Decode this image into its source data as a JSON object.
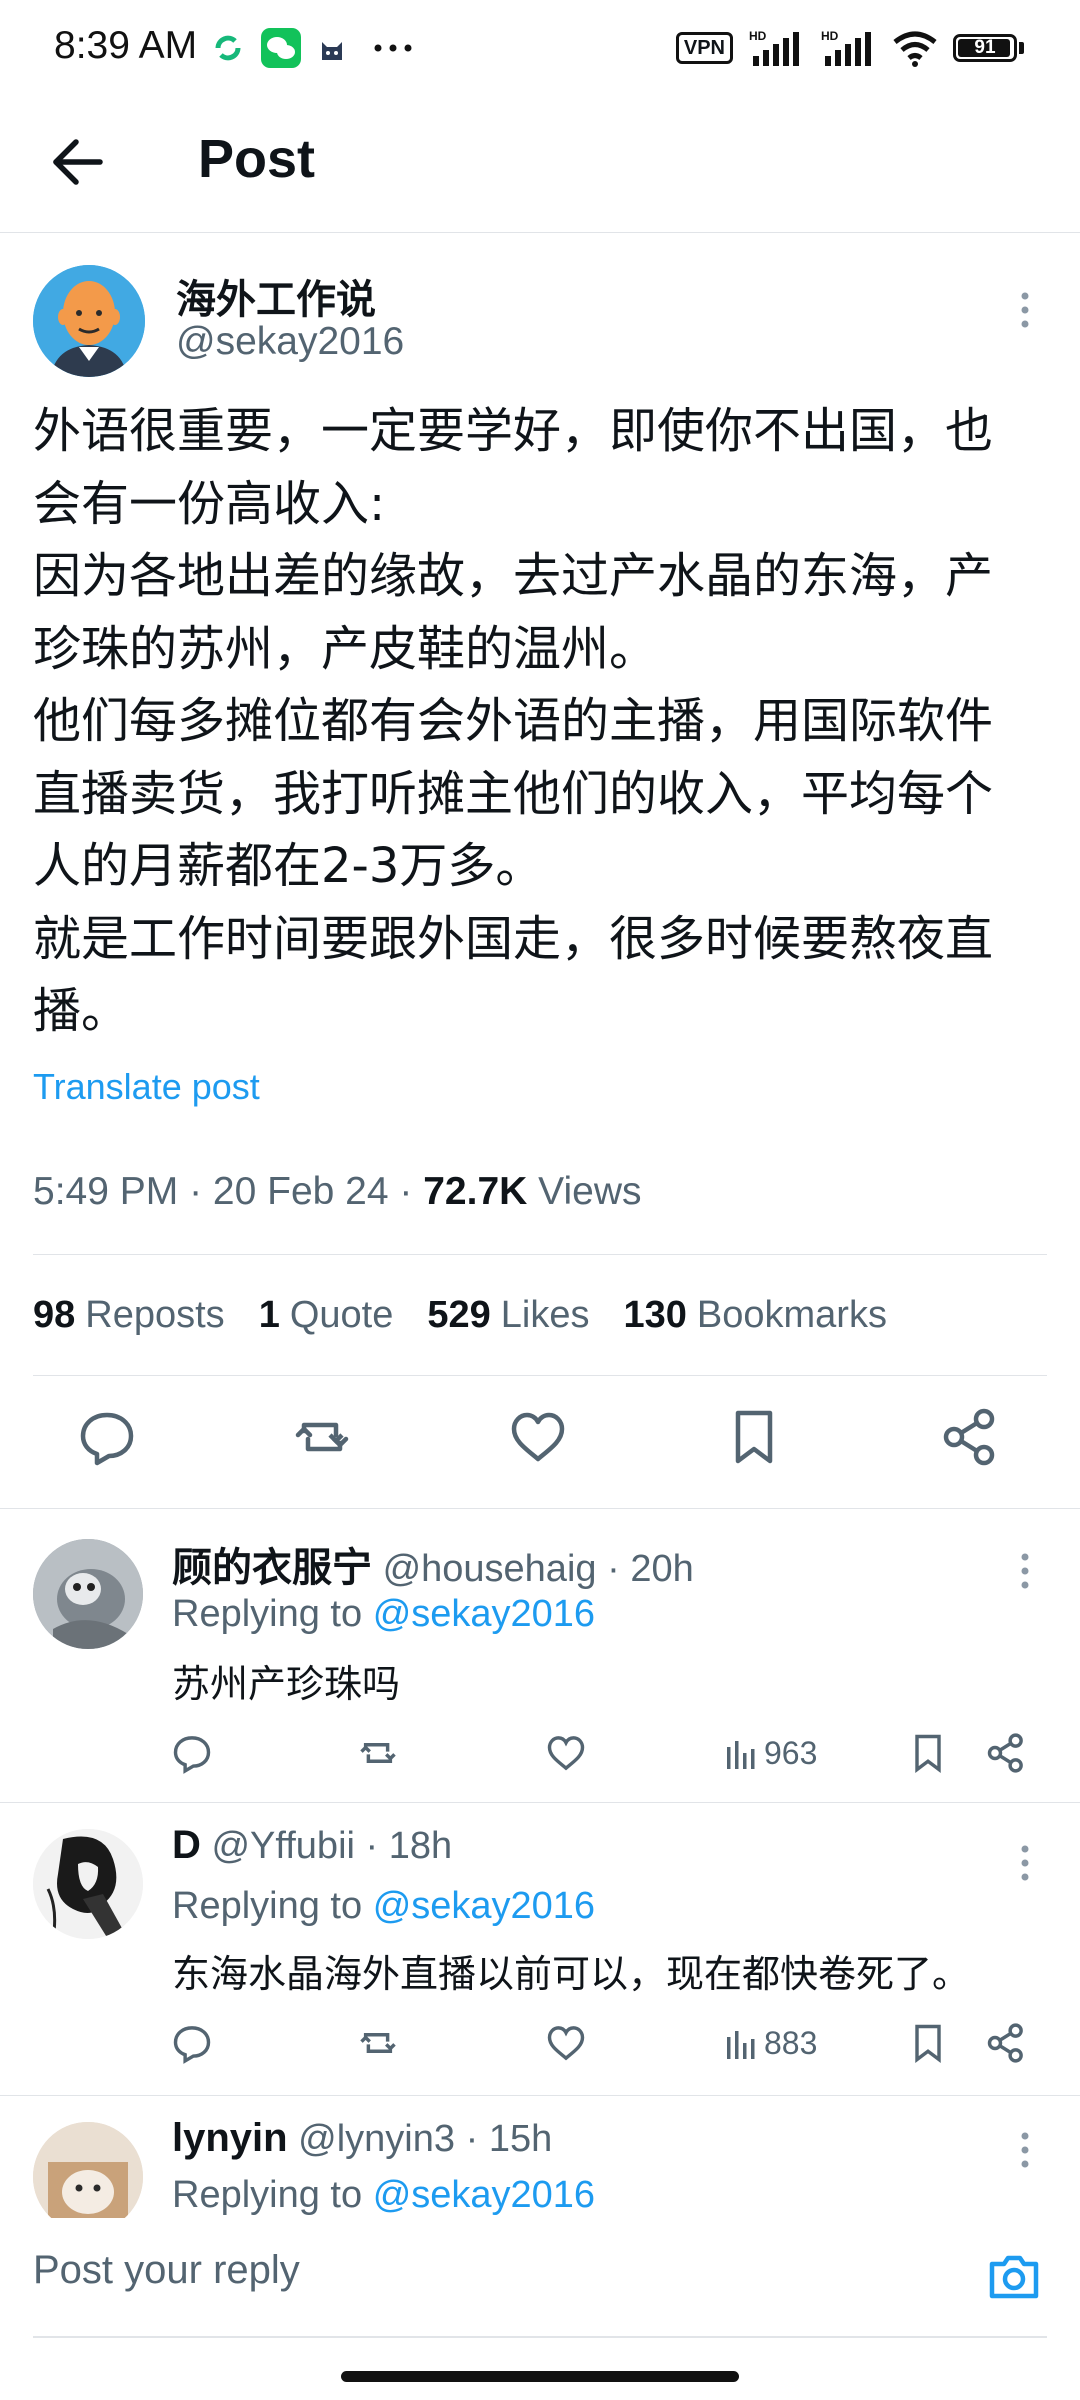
{
  "status_bar": {
    "time": "8:39 AM",
    "app_icons": [
      "sync-icon",
      "wechat-icon",
      "cat-icon",
      "more-icon"
    ],
    "vpn_label": "VPN",
    "network_labels": [
      "HD",
      "HD"
    ],
    "battery": "91"
  },
  "header": {
    "title": "Post"
  },
  "post": {
    "author_name": "海外工作说",
    "author_handle": "@sekay2016",
    "text": "外语很重要，一定要学好，即使你不出国，也\n会有一份高收入:\n因为各地出差的缘故，去过产水晶的东海，产\n珍珠的苏州，产皮鞋的温州。\n他们每多摊位都有会外语的主播，用国际软件\n直播卖货，我打听摊主他们的收入，平均每个\n人的月薪都在2-3万多。\n就是工作时间要跟外国走，很多时候要熬夜直\n播。",
    "translate_label": "Translate post",
    "time": "5:49 PM",
    "date": "20 Feb 24",
    "views_count": "72.7K",
    "views_label": "Views",
    "stats": [
      {
        "count": "98",
        "label": "Reposts"
      },
      {
        "count": "1",
        "label": "Quote"
      },
      {
        "count": "529",
        "label": "Likes"
      },
      {
        "count": "130",
        "label": "Bookmarks"
      }
    ]
  },
  "replies": [
    {
      "name": "顾的衣服宁",
      "handle": "@househaig",
      "age": "20h",
      "replying_prefix": "Replying to",
      "replying_handle": "@sekay2016",
      "text": "苏州产珍珠吗",
      "views": "963"
    },
    {
      "name": "D",
      "handle": "@Yffubii",
      "age": "18h",
      "replying_prefix": "Replying to",
      "replying_handle": "@sekay2016",
      "text": "东海水晶海外直播以前可以，现在都快卷死了。",
      "views": "883"
    },
    {
      "name": "lynyin",
      "handle": "@lynyin3",
      "age": "15h",
      "replying_prefix": "Replying to",
      "replying_handle": "@sekay2016"
    }
  ],
  "reply_bar": {
    "placeholder": "Post your reply"
  },
  "colors": {
    "accent": "#1d9bf0",
    "text_primary": "#0f1419",
    "text_secondary": "#536471",
    "divider": "#e1e4e8"
  }
}
